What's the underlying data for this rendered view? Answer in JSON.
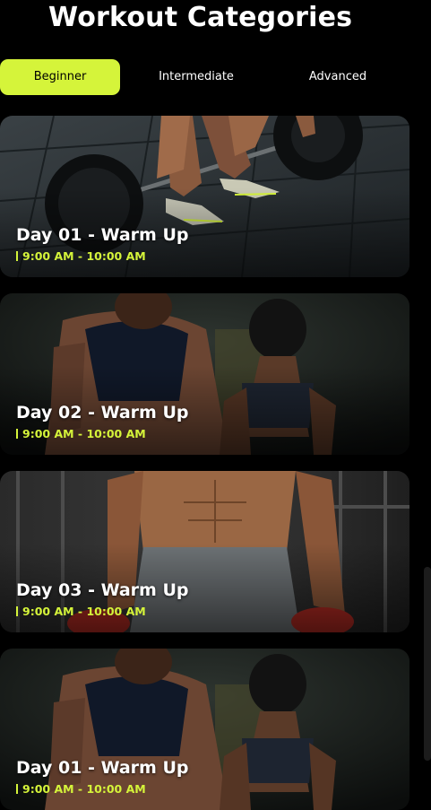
{
  "header": {
    "title": "Workout Categories"
  },
  "tabs": [
    {
      "label": "Beginner",
      "active": true
    },
    {
      "label": "Intermediate",
      "active": false
    },
    {
      "label": "Advanced",
      "active": false
    }
  ],
  "workouts": [
    {
      "title": "Day 01 - Warm Up",
      "time": "9:00 AM - 10:00 AM"
    },
    {
      "title": "Day 02 - Warm Up",
      "time": "9:00 AM - 10:00 AM"
    },
    {
      "title": "Day 03 - Warm Up",
      "time": "9:00 AM - 10:00 AM"
    },
    {
      "title": "Day 01 - Warm Up",
      "time": "9:00 AM - 10:00 AM"
    }
  ],
  "colors": {
    "accent": "#d5f43a",
    "background": "#000000"
  },
  "icons": {
    "time_marker": "vertical-bar-icon"
  }
}
